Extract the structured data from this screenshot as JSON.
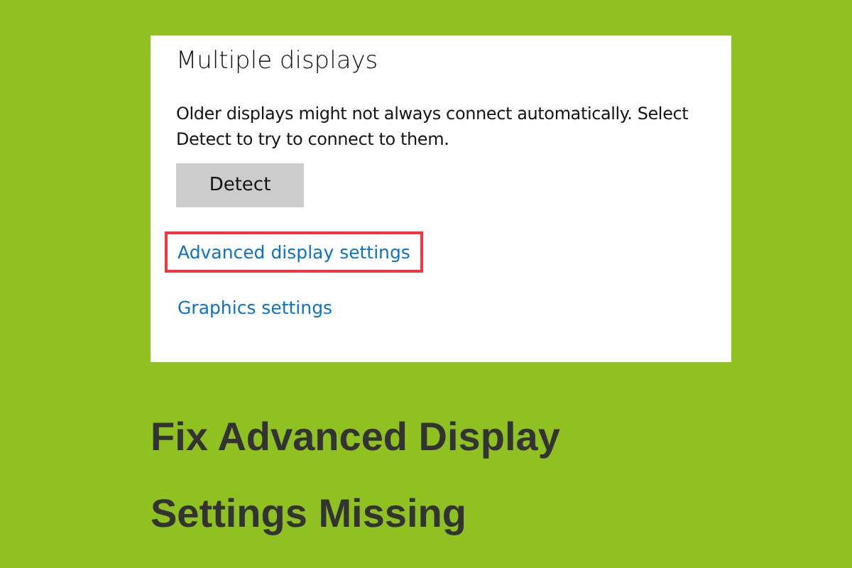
{
  "panel": {
    "heading": "Multiple displays",
    "description": "Older displays might not always connect automatically. Select Detect to try to connect to them.",
    "button": "Detect",
    "links": [
      {
        "label": "Advanced display settings",
        "highlighted": true
      },
      {
        "label": "Graphics settings",
        "highlighted": false
      }
    ]
  },
  "headline": "Fix Advanced Display Settings Missing"
}
